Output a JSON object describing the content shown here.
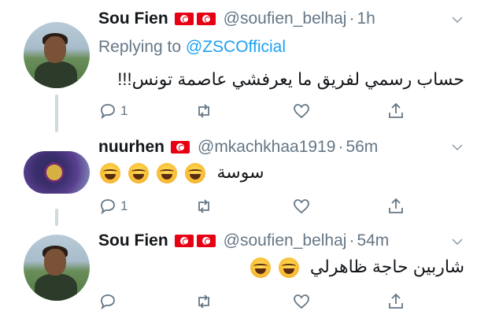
{
  "tweets": [
    {
      "name": "Sou Fien",
      "handle": "@soufien_belhaj",
      "dot": "·",
      "time": "1h",
      "replying_prefix": "Replying to",
      "replying_to": "@ZSCOfficial",
      "text": "حساب رسمي لفريق ما يعرفشي عاصمة تونس!!!",
      "reply_count": "1",
      "flags": [
        "tunisia-flag",
        "tunisia-flag"
      ]
    },
    {
      "name": "nuurhen",
      "handle": "@mkachkhaa1919",
      "dot": "·",
      "time": "56m",
      "text": "سوسة",
      "emoji_count": 4,
      "reply_count": "1",
      "flags": [
        "tunisia-flag"
      ]
    },
    {
      "name": "Sou Fien",
      "handle": "@soufien_belhaj",
      "dot": "·",
      "time": "54m",
      "text": "شاربين حاجة ظاهرلي",
      "emoji_count": 2,
      "reply_count": "",
      "flags": [
        "tunisia-flag",
        "tunisia-flag"
      ]
    }
  ],
  "icons": {
    "reply": "reply-icon",
    "retweet": "retweet-icon",
    "like": "heart-icon",
    "share": "share-icon",
    "more": "chevron-down-icon",
    "emoji": "face-with-tears-of-joy-emoji"
  },
  "colors": {
    "link": "#1da1f2",
    "muted": "#657786",
    "flag_red": "#e70013",
    "thread_line": "#cfd9de"
  }
}
